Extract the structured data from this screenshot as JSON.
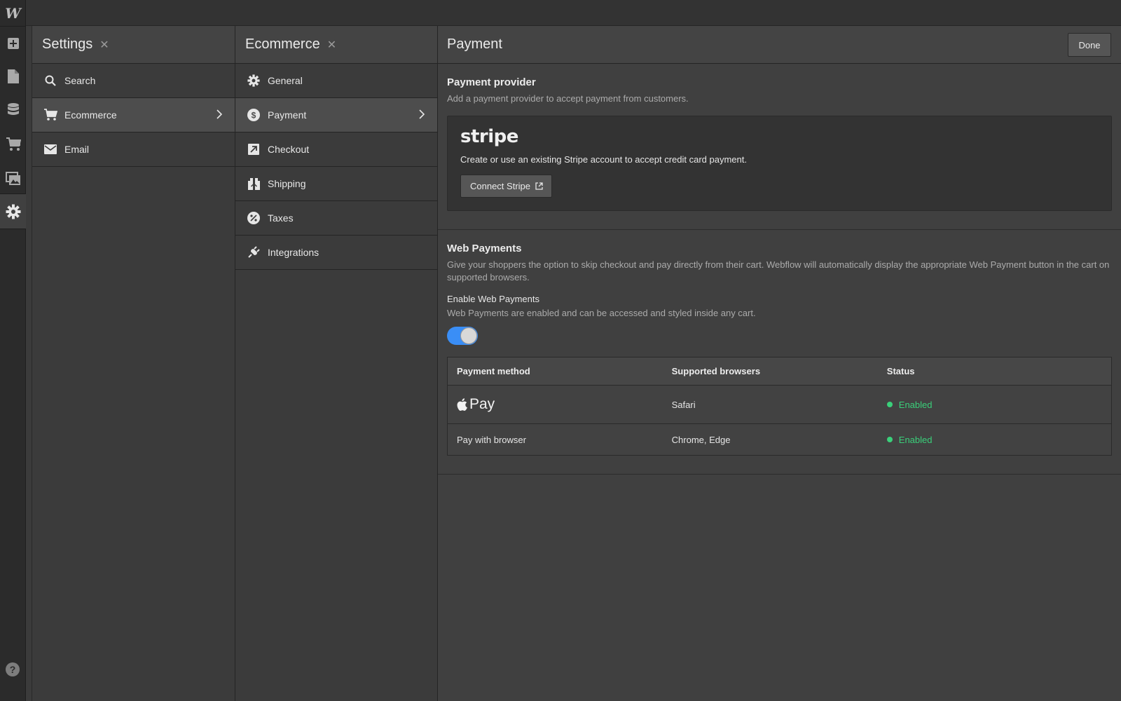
{
  "app": {
    "logo_letter": "W",
    "colors": {
      "accent": "#3a8ef6",
      "enabled": "#3ad07a",
      "background": "#404040",
      "sidebar": "#2b2b2b"
    }
  },
  "leftbar": {
    "icons": [
      "add-icon",
      "pages-icon",
      "cms-icon",
      "ecommerce-cart-icon",
      "assets-icon",
      "settings-gear-icon",
      "help-icon"
    ]
  },
  "settings_panel": {
    "title": "Settings",
    "close_symbol": "✕",
    "items": [
      {
        "label": "Search",
        "icon": "search-icon"
      },
      {
        "label": "Ecommerce",
        "icon": "cart-icon",
        "selected": true
      },
      {
        "label": "Email",
        "icon": "envelope-icon"
      }
    ]
  },
  "ecommerce_panel": {
    "title": "Ecommerce",
    "close_symbol": "✕",
    "items": [
      {
        "label": "General",
        "icon": "gear-icon"
      },
      {
        "label": "Payment",
        "icon": "dollar-icon",
        "selected": true
      },
      {
        "label": "Checkout",
        "icon": "checkout-arrow-icon"
      },
      {
        "label": "Shipping",
        "icon": "shipping-box-icon"
      },
      {
        "label": "Taxes",
        "icon": "percent-icon"
      },
      {
        "label": "Integrations",
        "icon": "plug-icon"
      }
    ]
  },
  "main": {
    "title": "Payment",
    "done_label": "Done",
    "provider": {
      "heading": "Payment provider",
      "description": "Add a payment provider to accept payment from customers.",
      "stripe_logo": "stripe",
      "stripe_description": "Create or use an existing Stripe account to accept credit card payment.",
      "connect_label": "Connect Stripe"
    },
    "web_payments": {
      "heading": "Web Payments",
      "description": "Give your shoppers the option to skip checkout and pay directly from their cart. Webflow will automatically display the appropriate Web Payment button in the cart on supported browsers.",
      "enable_label": "Enable Web Payments",
      "enable_description": "Web Payments are enabled and can be accessed and styled inside any cart.",
      "enabled": true,
      "table": {
        "headers": [
          "Payment method",
          "Supported browsers",
          "Status"
        ],
        "rows": [
          {
            "method": "Pay",
            "method_icon": "apple-icon",
            "browsers": "Safari",
            "status": "Enabled"
          },
          {
            "method": "Pay with browser",
            "browsers": "Chrome, Edge",
            "status": "Enabled"
          }
        ]
      }
    }
  }
}
